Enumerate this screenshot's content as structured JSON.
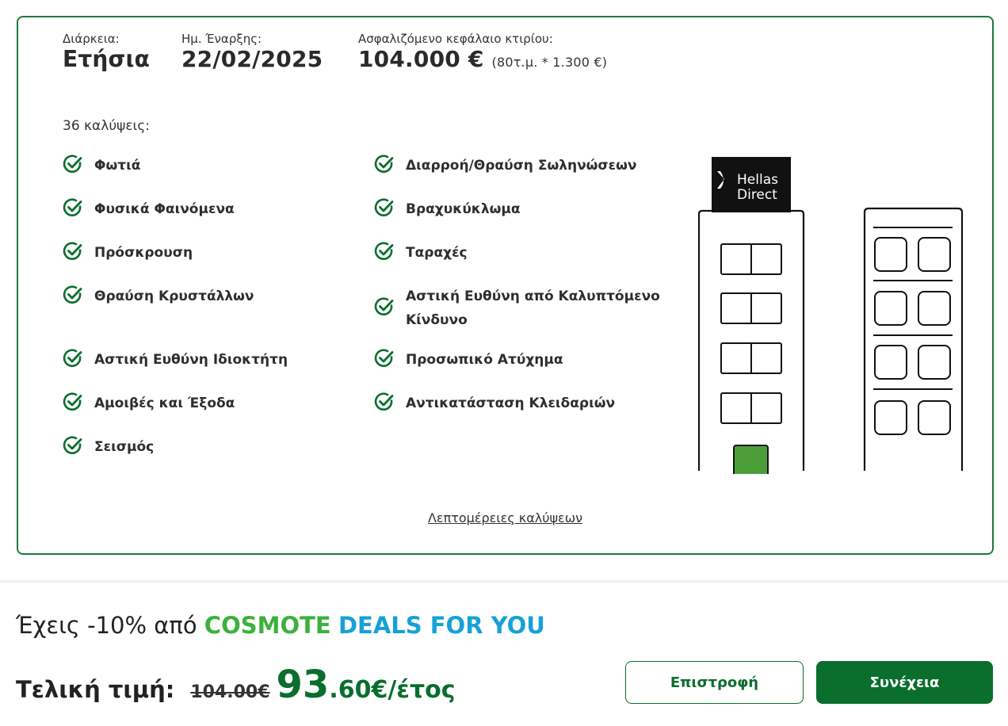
{
  "policy": {
    "duration_label": "Διάρκεια:",
    "duration_value": "Ετήσια",
    "start_label": "Ημ. Έναρξης:",
    "start_value": "22/02/2025",
    "capital_label": "Ασφαλιζόμενο κεφάλαιο κτιρίου:",
    "capital_value": "104.000 €",
    "capital_detail": "(80τ.μ. * 1.300 €)"
  },
  "coverages": {
    "count_label": "36 καλύψεις:",
    "left": [
      "Φωτιά",
      "Φυσικά Φαινόμενα",
      "Πρόσκρουση",
      "Θραύση Κρυστάλλων",
      "Αστική Ευθύνη Ιδιοκτήτη",
      "Αμοιβές και Έξοδα",
      "Σεισμός"
    ],
    "right": [
      "Διαρροή/Θραύση Σωληνώσεων",
      "Βραχυκύκλωμα",
      "Ταραχές",
      "Αστική Ευθύνη από Καλυπτόμενο",
      "Κίνδυνο",
      "Προσωπικό Ατύχημα",
      "Αντικατάσταση Κλειδαριών"
    ],
    "details_link": "Λεπτομέρειες καλύψεων"
  },
  "logo": {
    "line1": "Hellas",
    "line2": "Direct"
  },
  "promo": {
    "prefix": "Έχεις -10% από",
    "brand": "COSMOTE",
    "deals": "DEALS FOR YOU"
  },
  "price": {
    "label": "Τελική τιμή:",
    "old": "104.00€",
    "main": "93",
    "cents": ".60€/έτος"
  },
  "buttons": {
    "back": "Επιστροφή",
    "next": "Συνέχεια"
  },
  "colors": {
    "accent": "#0a6e2c",
    "border": "#1e7a3a",
    "cosmote": "#3cb13c",
    "deals": "#17a1d8"
  }
}
